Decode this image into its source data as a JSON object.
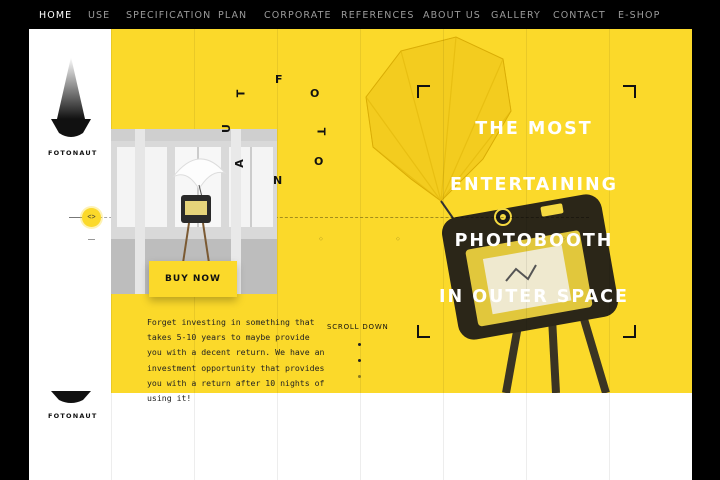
{
  "nav": {
    "items": [
      {
        "label": "HOME",
        "active": true
      },
      {
        "label": "USE"
      },
      {
        "label": "SPECIFICATION"
      },
      {
        "label": "PLAN"
      },
      {
        "label": "CORPORATE"
      },
      {
        "label": "REFERENCES"
      },
      {
        "label": "ABOUT US"
      },
      {
        "label": "GALLERY"
      },
      {
        "label": "CONTACT"
      },
      {
        "label": "E-SHOP"
      }
    ]
  },
  "brand": {
    "name": "FOTONAUT",
    "name_footer": "FOTONAUT"
  },
  "hero": {
    "headline_lines": [
      "THE MOST",
      "ENTERTAINING",
      "PHOTOBOOTH",
      "IN OUTER SPACE"
    ],
    "curved_letters": [
      "F",
      "O",
      "T",
      "O",
      "N",
      "A",
      "U",
      "T"
    ],
    "buy_label": "BUY NOW",
    "body_text": "Forget investing in something that takes 5-10 years to maybe provide you with a decent return. We have an investment opportunity that provides you with a return after 10 nights of using it!",
    "scroll_label": "SCROLL DOWN"
  },
  "colors": {
    "accent": "#fbd92a",
    "dark": "#111111",
    "nav_bg": "#000000",
    "nav_text": "#9a9a9a",
    "nav_active": "#ffffff"
  },
  "icons": {
    "slider": "arrows-left-right-icon"
  }
}
